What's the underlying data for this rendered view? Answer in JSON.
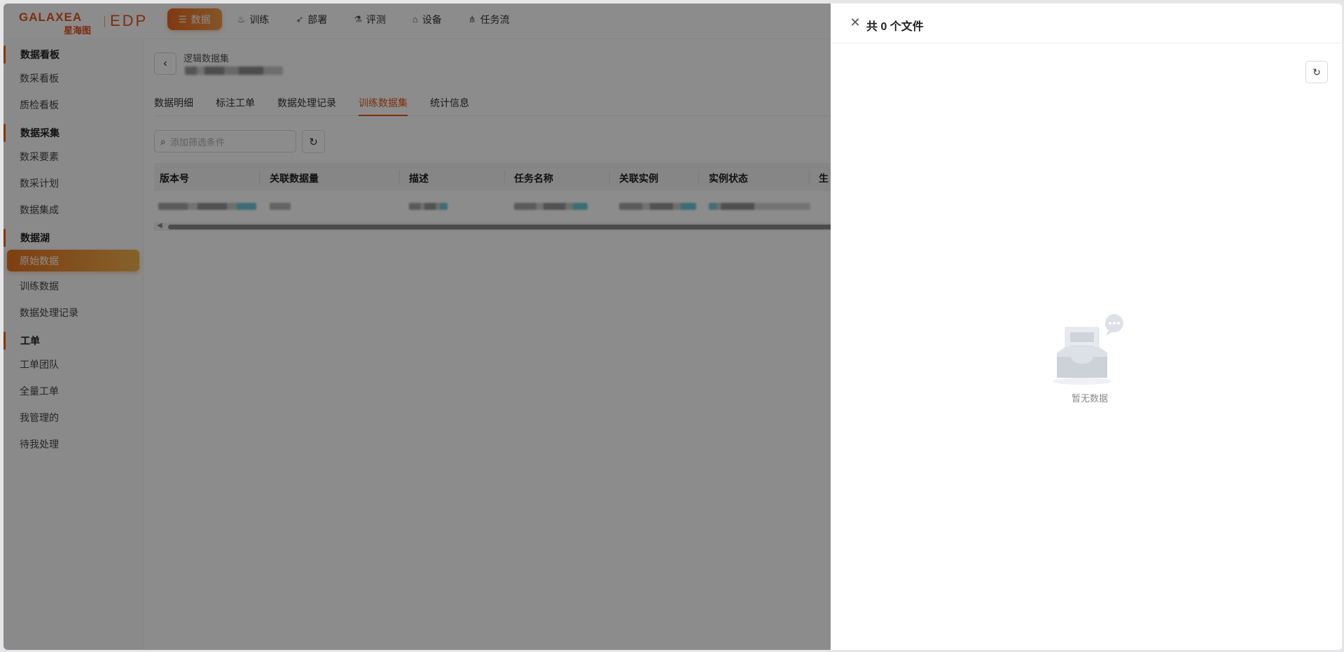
{
  "logo": {
    "brand": "GALAXEA",
    "brand_sub": "星海图",
    "product": "EDP"
  },
  "nav": [
    {
      "label": "数据",
      "icon": "database-icon",
      "active": true
    },
    {
      "label": "训练",
      "icon": "flame-icon"
    },
    {
      "label": "部署",
      "icon": "rocket-icon"
    },
    {
      "label": "评测",
      "icon": "flask-icon"
    },
    {
      "label": "设备",
      "icon": "robot-icon"
    },
    {
      "label": "任务流",
      "icon": "workflow-icon"
    }
  ],
  "sidebar": {
    "groups": [
      {
        "title": "数据看板",
        "items": [
          "数采看板",
          "质检看板"
        ]
      },
      {
        "title": "数据采集",
        "items": [
          "数采要素",
          "数采计划",
          "数据集成"
        ]
      },
      {
        "title": "数据湖",
        "items": [
          "原始数据",
          "训练数据",
          "数据处理记录"
        ]
      },
      {
        "title": "工单",
        "items": [
          "工单团队",
          "全量工单",
          "我管理的",
          "待我处理"
        ]
      }
    ],
    "active_item": "原始数据"
  },
  "breadcrumb": {
    "title": "逻辑数据集"
  },
  "tabs": [
    "数据明细",
    "标注工单",
    "数据处理记录",
    "训练数据集",
    "统计信息"
  ],
  "active_tab": "训练数据集",
  "filter": {
    "placeholder": "添加筛选条件"
  },
  "table": {
    "columns": [
      "版本号",
      "关联数据量",
      "描述",
      "任务名称",
      "关联实例",
      "实例状态",
      "生"
    ]
  },
  "drawer": {
    "title": "共 0 个文件",
    "empty_text": "暂无数据"
  },
  "colors": {
    "accent": "#e2551d",
    "overlay": "rgba(0,0,0,0.45)"
  }
}
